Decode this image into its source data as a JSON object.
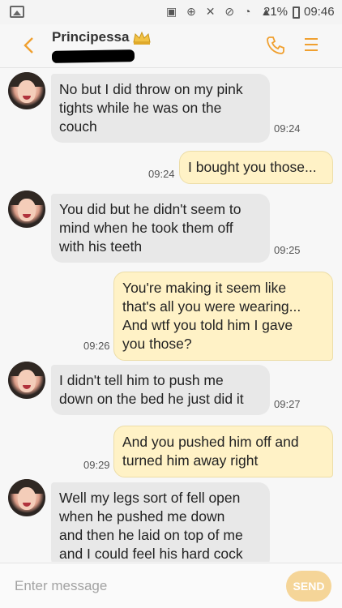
{
  "status_bar": {
    "battery_percent": "21%",
    "time": "09:46"
  },
  "header": {
    "contact_name": "Principessa",
    "accent_color": "#f0a030"
  },
  "messages": [
    {
      "direction": "incoming",
      "text_lines": [
        "No but I did throw on my pink",
        "tights while he was on the",
        "couch"
      ],
      "time": "09:24"
    },
    {
      "direction": "outgoing",
      "text_lines": [
        "I bought you those..."
      ],
      "time": "09:24"
    },
    {
      "direction": "incoming",
      "text_lines": [
        "You did but he didn't seem to",
        "mind when he took them off",
        "with his teeth"
      ],
      "time": "09:25"
    },
    {
      "direction": "outgoing",
      "text_lines": [
        "You're making it seem like",
        "that's all you were wearing...",
        "And wtf you told him I gave",
        "you those?"
      ],
      "time": "09:26"
    },
    {
      "direction": "incoming",
      "text_lines": [
        "I didn't tell him to push me",
        "down on the bed he just did it"
      ],
      "time": "09:27"
    },
    {
      "direction": "outgoing",
      "text_lines": [
        "And you pushed him off and",
        "turned him away right"
      ],
      "time": "09:29"
    },
    {
      "direction": "incoming",
      "text_lines": [
        "Well my legs sort of fell open",
        "when he pushed me down",
        "and then he laid on top of me",
        "and I could feel his hard cock"
      ],
      "time": ""
    }
  ],
  "composer": {
    "placeholder": "Enter message",
    "send_label": "SEND"
  }
}
